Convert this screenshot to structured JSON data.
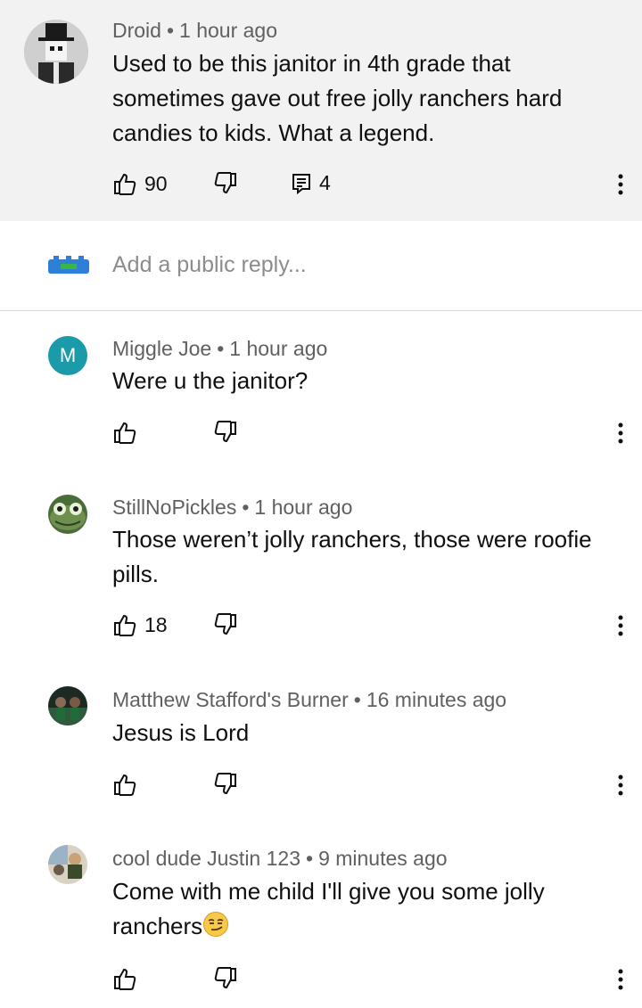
{
  "top_comment": {
    "author": "Droid",
    "time": "1 hour ago",
    "text_lines": [
      "Used to be this janitor in 4th grade that",
      "sometimes gave out free jolly ranchers hard",
      "candies to kids. What a legend."
    ],
    "likes": "90",
    "replies": "4"
  },
  "reply_box": {
    "placeholder": "Add a public reply..."
  },
  "replies": [
    {
      "author": "Miggle Joe",
      "time": "1 hour ago",
      "avatar_letter": "M",
      "avatar_color": "#1b9aaa",
      "text_lines": [
        "Were u the janitor?"
      ],
      "likes": ""
    },
    {
      "author": "StillNoPickles",
      "time": "1 hour ago",
      "text_lines": [
        "Those weren’t jolly ranchers, those were roofie",
        "pills."
      ],
      "likes": "18"
    },
    {
      "author": "Matthew Stafford's Burner",
      "time": "16 minutes ago",
      "text_lines": [
        "Jesus is Lord"
      ],
      "likes": ""
    },
    {
      "author": "cool dude Justin 123",
      "time": "9 minutes ago",
      "text_lines": [
        "Come with me child I'll give you some jolly",
        "ranchers"
      ],
      "emoji": "smirking-face",
      "likes": ""
    }
  ],
  "icons": {
    "like": "thumbs-up-icon",
    "dislike": "thumbs-down-icon",
    "reply": "reply-icon",
    "more": "more-vertical-icon"
  },
  "colors": {
    "background_top": "#f2f2f2",
    "meta_text": "#606060",
    "placeholder": "#8c8c8c"
  }
}
